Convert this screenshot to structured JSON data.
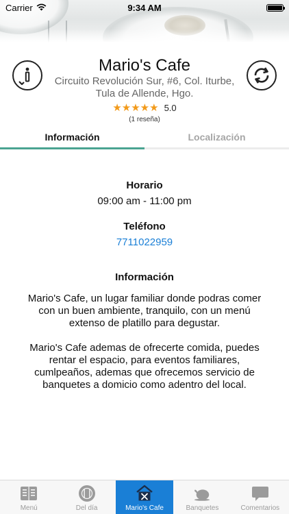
{
  "status_bar": {
    "carrier": "Carrier",
    "time": "9:34 AM"
  },
  "restaurant": {
    "name": "Mario's Cafe",
    "address": "Circuito Revolución Sur, #6, Col. Iturbe, Tula de Allende, Hgo.",
    "stars": "★★★★★",
    "rating": "5.0",
    "reviews": "(1 reseña)"
  },
  "tabs": {
    "info": "Información",
    "location": "Localización",
    "active_index": 0
  },
  "details": {
    "hours_title": "Horario",
    "hours_value": "09:00 am - 11:00 pm",
    "phone_title": "Teléfono",
    "phone_value": "7711022959",
    "info_title": "Información",
    "paragraph_1": "Mario's Cafe, un lugar familiar donde podras comer con un buen ambiente, tranquilo, con un menú extenso de platillo para degustar.",
    "paragraph_2": "Mario's Cafe ademas de ofrecerte comida, puedes rentar el espacio, para eventos familiares, cumlpeaños, ademas que ofrecemos servicio de banquetes a domicio como adentro del local."
  },
  "tabbar": {
    "items": [
      {
        "label": "Menú",
        "icon": "menu-book-icon"
      },
      {
        "label": "Del día",
        "icon": "plate-icon"
      },
      {
        "label": "Mario's Cafe",
        "icon": "restaurant-home-icon"
      },
      {
        "label": "Banquetes",
        "icon": "chicken-icon"
      },
      {
        "label": "Comentarios",
        "icon": "chat-bubble-icon"
      }
    ],
    "active_index": 2
  },
  "colors": {
    "accent": "#1a7fd6",
    "tab_indicator": "#4aa391",
    "stars": "#f29a1a",
    "link": "#1a7fd6"
  }
}
